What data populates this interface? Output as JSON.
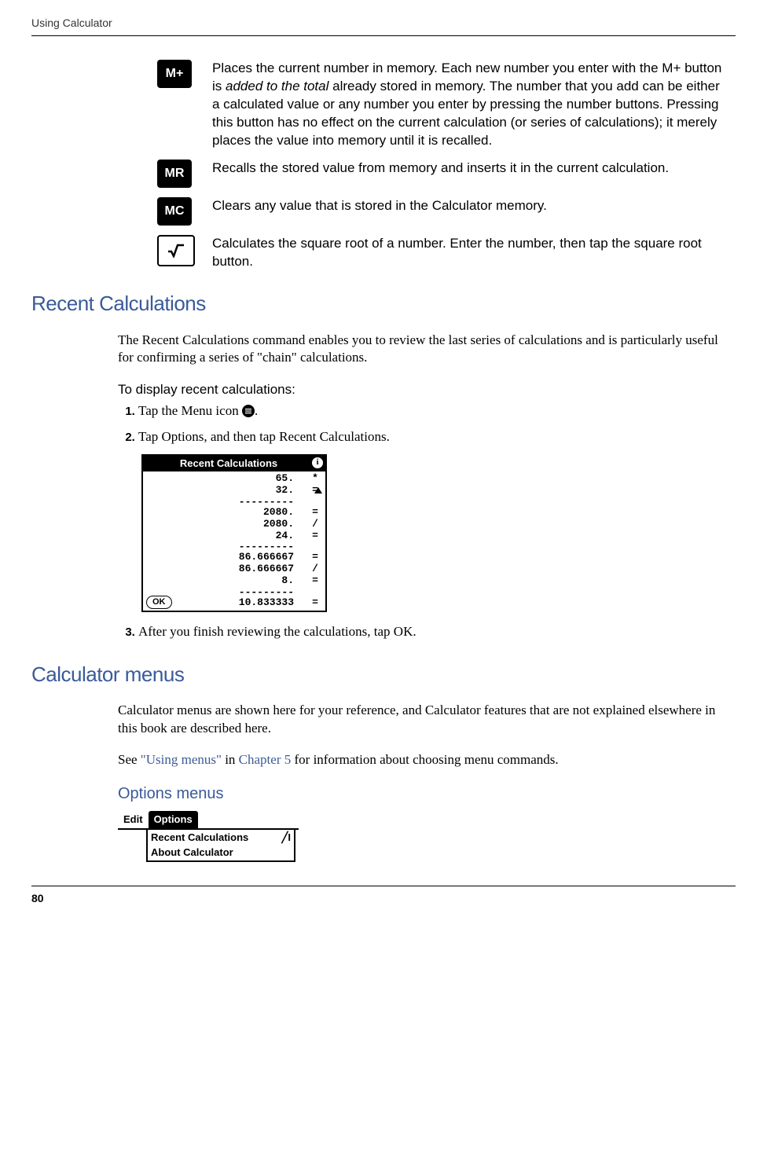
{
  "runningHeader": "Using Calculator",
  "pageNumber": "80",
  "buttons": {
    "mplus": {
      "label": "M+",
      "desc_pre": "Places the current number in memory. Each new number you enter with the M+ button is ",
      "desc_italic": "added to the total",
      "desc_post": " already stored in memory. The number that you add can be either a calculated value or any number you enter by pressing the number buttons. Pressing this button has no effect on the current calculation (or series of calculations); it merely places the value into memory until it is recalled."
    },
    "mr": {
      "label": "MR",
      "desc": "Recalls the stored value from memory and inserts it in the current calculation."
    },
    "mc": {
      "label": "MC",
      "desc": "Clears any value that is stored in the Calculator memory."
    },
    "sqrt": {
      "label": "√",
      "desc": "Calculates the square root of a number. Enter the number, then tap the square root button."
    }
  },
  "section1": {
    "heading": "Recent Calculations",
    "para": "The Recent Calculations command enables you to review the last series of calculations and is particularly useful for confirming a series of \"chain\" calculations.",
    "taskTitle": "To display recent calculations:",
    "step1": "Tap the Menu icon ",
    "step1_end": ".",
    "step2": "Tap Options, and then tap Recent Calculations.",
    "step3": "After you finish reviewing the calculations, tap OK."
  },
  "recentScreen": {
    "title": "Recent Calculations",
    "rows": [
      {
        "val": "65.",
        "op": "*"
      },
      {
        "val": "32.",
        "op": "="
      },
      {
        "sep": "---------"
      },
      {
        "val": "2080.",
        "op": "="
      },
      {
        "val": "2080.",
        "op": "/"
      },
      {
        "val": "24.",
        "op": "="
      },
      {
        "sep": "---------"
      },
      {
        "val": "86.666667",
        "op": "="
      },
      {
        "val": "86.666667",
        "op": "/"
      },
      {
        "val": "8.",
        "op": "="
      },
      {
        "sep": "---------"
      },
      {
        "val": "10.833333",
        "op": "="
      }
    ],
    "ok": "OK"
  },
  "section2": {
    "heading": "Calculator menus",
    "para1": "Calculator menus are shown here for your reference, and Calculator features that are not explained elsewhere in this book are described here.",
    "para2_pre": "See ",
    "para2_link1": "\"Using menus\"",
    "para2_mid": " in ",
    "para2_link2": "Chapter 5",
    "para2_post": " for information about choosing menu commands.",
    "subheading": "Options menus"
  },
  "optionsScreen": {
    "tab1": "Edit",
    "tab2": "Options",
    "item1": "Recent Calculations",
    "item1_shortcut": "╱I",
    "item2": "About Calculator"
  }
}
